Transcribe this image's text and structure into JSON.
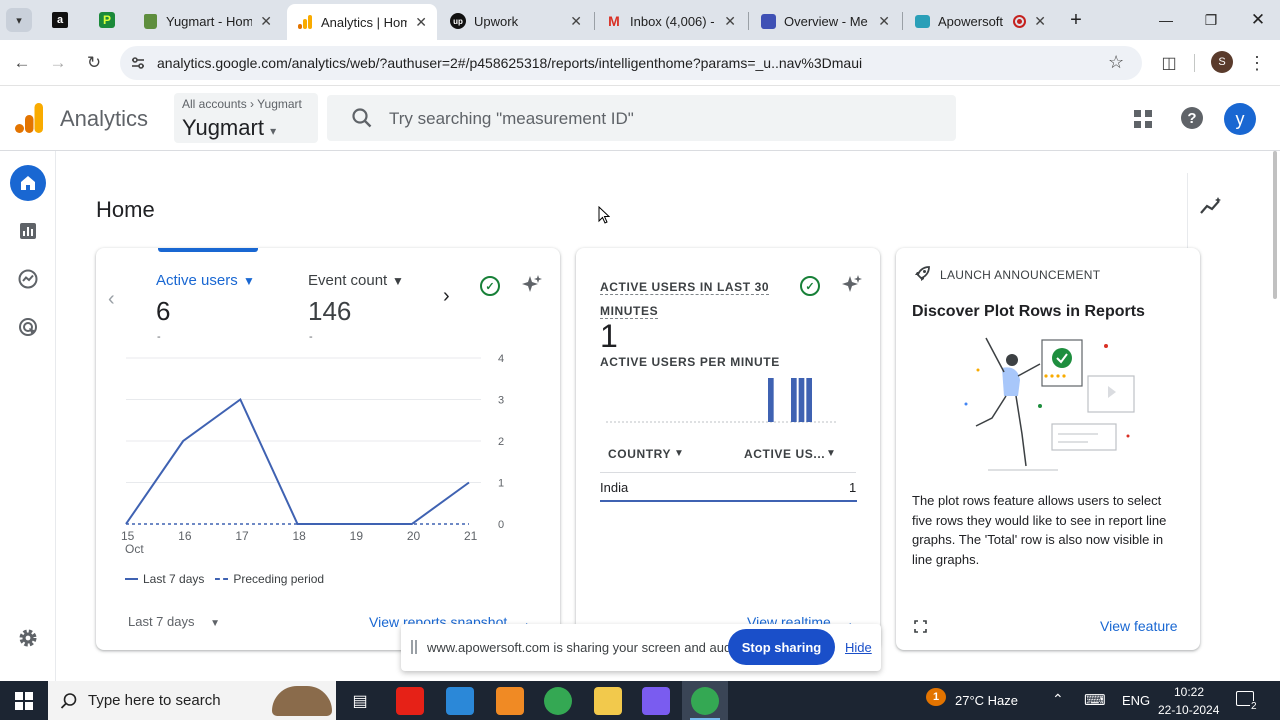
{
  "browser": {
    "tabs": [
      {
        "title": "Yugmart - Hom",
        "icon": "shopify-icon"
      },
      {
        "title": "Analytics | Hom",
        "icon": "analytics-icon",
        "active": true
      },
      {
        "title": "Upwork",
        "icon": "upwork-icon"
      },
      {
        "title": "Inbox (4,006) -",
        "icon": "gmail-icon"
      },
      {
        "title": "Overview - Me",
        "icon": "overview-icon"
      },
      {
        "title": "Apowersoft",
        "icon": "apowersoft-icon"
      }
    ],
    "url": "analytics.google.com/analytics/web/?authuser=2#/p458625318/reports/intelligenthome?params=_u..nav%3Dmaui",
    "profile_initial": "S"
  },
  "header": {
    "app_title": "Analytics",
    "breadcrumb_all": "All accounts",
    "breadcrumb_account": "Yugmart",
    "property": "Yugmart",
    "search_placeholder": "Try searching \"measurement ID\"",
    "avatar_initial": "y"
  },
  "page": {
    "title": "Home"
  },
  "overview_card": {
    "metrics": [
      {
        "label": "Active users",
        "value": "6",
        "delta": "-"
      },
      {
        "label": "Event count",
        "value": "146",
        "delta": "-"
      }
    ],
    "legend": {
      "current": "Last 7 days",
      "previous": "Preceding period"
    },
    "date_range": "Last 7 days",
    "link": "View reports snapshot"
  },
  "chart_data": {
    "type": "line",
    "x": [
      "15",
      "16",
      "17",
      "18",
      "19",
      "20",
      "21"
    ],
    "x_sub": "Oct",
    "series": [
      {
        "name": "Last 7 days",
        "values": [
          0,
          2,
          3,
          0,
          0,
          0,
          1
        ]
      },
      {
        "name": "Preceding period",
        "values": [
          0,
          0,
          0,
          0,
          0,
          0,
          0
        ]
      }
    ],
    "ylim": [
      0,
      4
    ],
    "yticks": [
      "0",
      "1",
      "2",
      "3",
      "4"
    ]
  },
  "realtime_card": {
    "title": "ACTIVE USERS IN LAST 30 MINUTES",
    "value": "1",
    "subtitle": "ACTIVE USERS PER MINUTE",
    "per_minute": [
      0,
      0,
      0,
      0,
      0,
      0,
      0,
      0,
      0,
      0,
      0,
      0,
      0,
      0,
      0,
      0,
      0,
      0,
      0,
      0,
      0,
      1,
      0,
      0,
      1,
      1,
      1,
      0,
      0,
      0
    ],
    "col_country": "COUNTRY",
    "col_users": "ACTIVE US...",
    "rows": [
      {
        "country": "India",
        "users": "1"
      }
    ],
    "link": "View realtime"
  },
  "announcement": {
    "label": "LAUNCH ANNOUNCEMENT",
    "headline": "Discover Plot Rows in Reports",
    "body": "The plot rows feature allows users to select five rows they would like to see in report line graphs. The 'Total' row is also now visible in line graphs.",
    "link": "View feature"
  },
  "share_bar": {
    "message": "www.apowersoft.com is sharing your screen and audio.",
    "stop_label": "Stop sharing",
    "hide_label": "Hide"
  },
  "taskbar": {
    "search_placeholder": "Type here to search",
    "weather": "27°C  Haze",
    "language": "ENG",
    "time": "10:22",
    "date": "22-10-2024",
    "notification_count": "2"
  },
  "colors": {
    "accent": "#1967d2",
    "primary_line": "#3f62b2",
    "ga_orange": "#f9ab00",
    "ga_dark_orange": "#e37400"
  }
}
